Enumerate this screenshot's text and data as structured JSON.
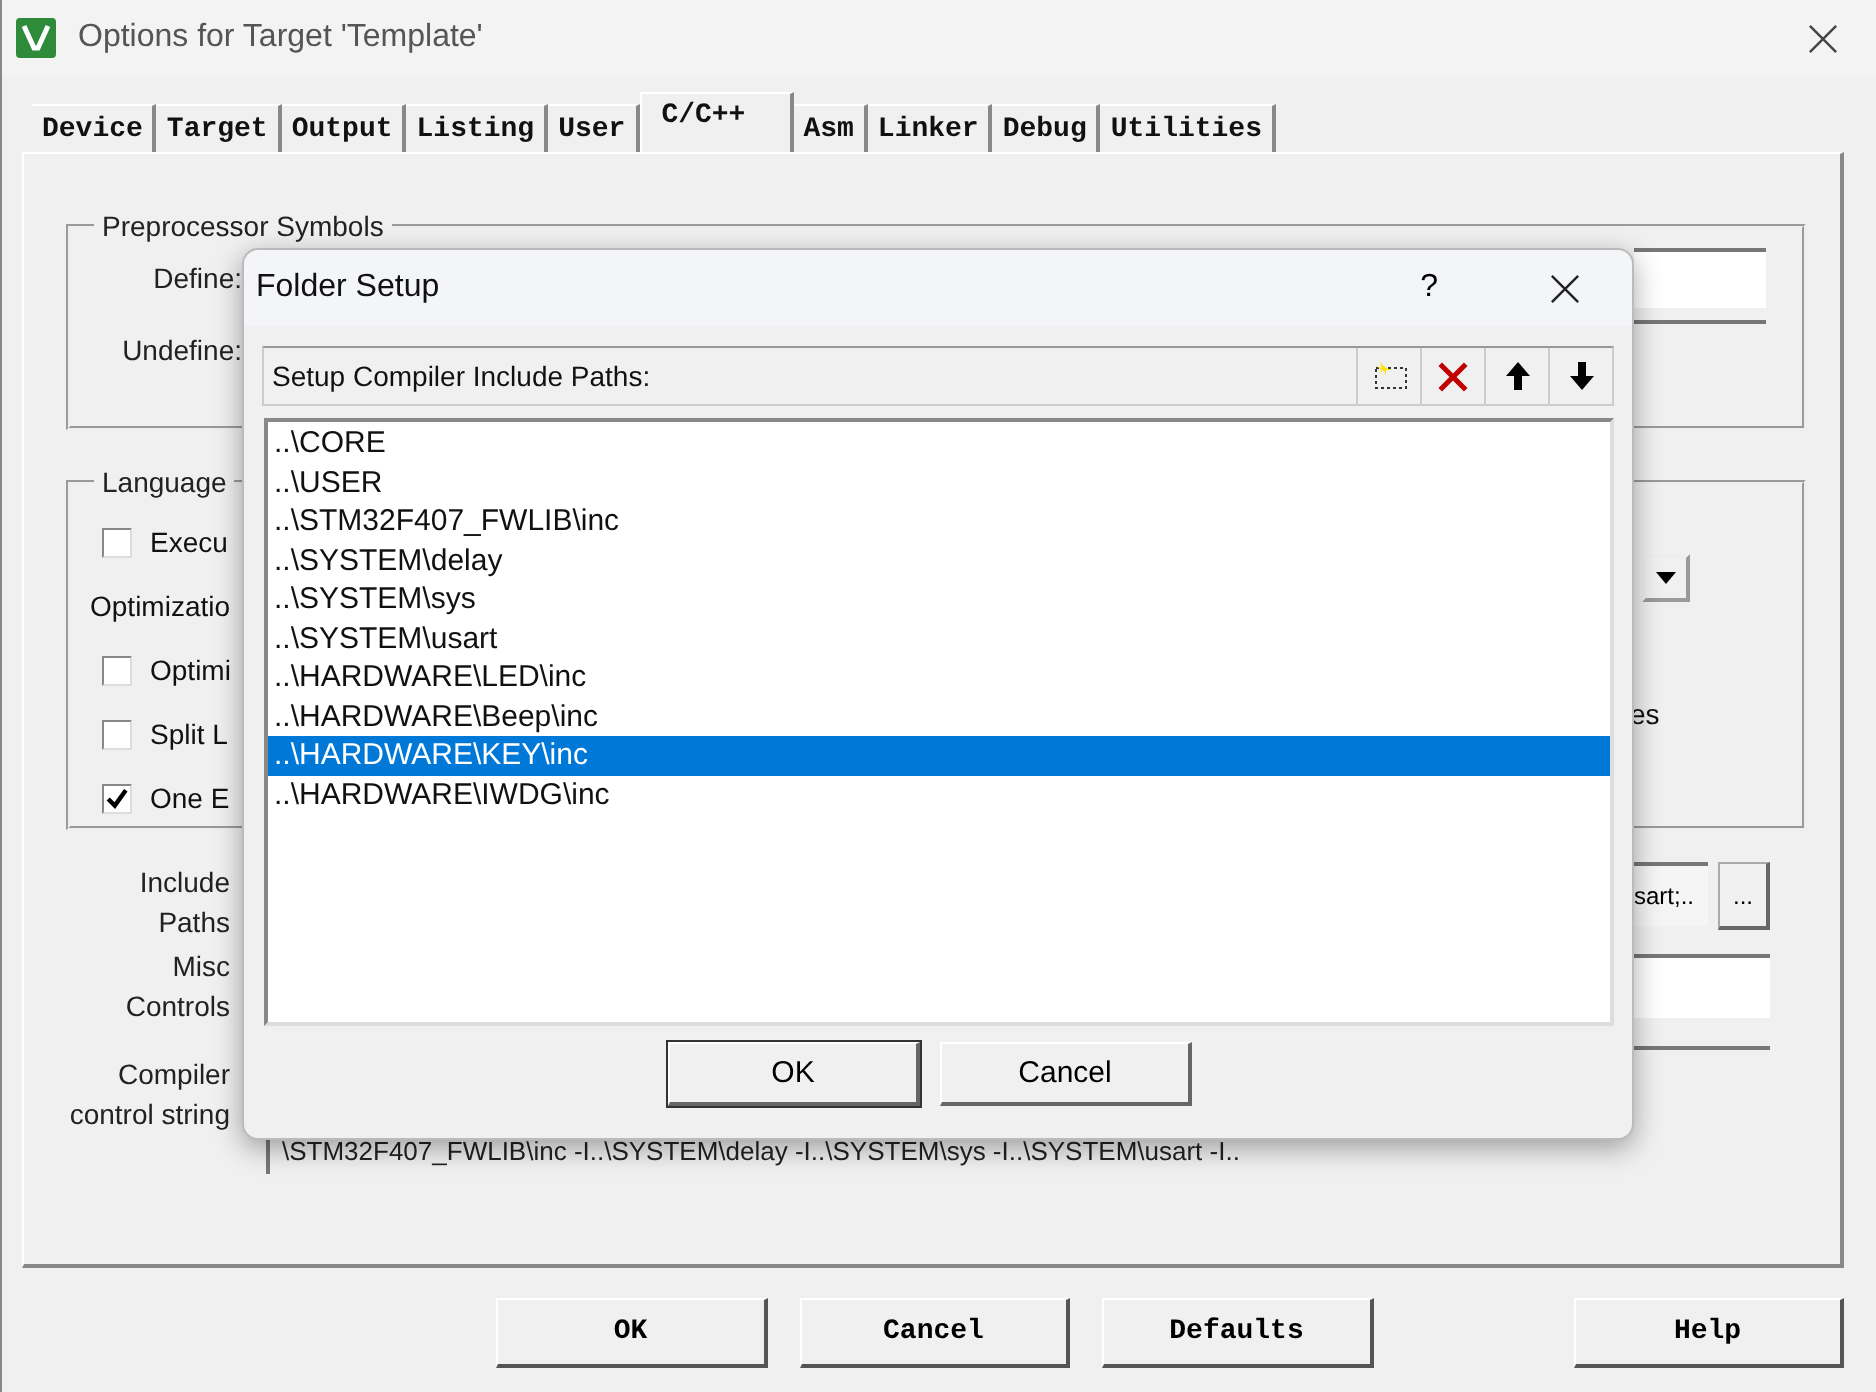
{
  "window": {
    "title": "Options for Target 'Template'"
  },
  "tabs": [
    {
      "label": "Device",
      "selected": false
    },
    {
      "label": "Target",
      "selected": false
    },
    {
      "label": "Output",
      "selected": false
    },
    {
      "label": "Listing",
      "selected": false
    },
    {
      "label": "User",
      "selected": false
    },
    {
      "label": "C/C++",
      "selected": true
    },
    {
      "label": "Asm",
      "selected": false
    },
    {
      "label": "Linker",
      "selected": false
    },
    {
      "label": "Debug",
      "selected": false
    },
    {
      "label": "Utilities",
      "selected": false
    }
  ],
  "preprocessor": {
    "title": "Preprocessor Symbols",
    "define_label": "Define:",
    "undefine_label": "Undefine:"
  },
  "language": {
    "title": "Language",
    "options": [
      {
        "kind": "checkbox",
        "label": "Execu",
        "checked": false
      },
      {
        "kind": "label",
        "label": "Optimizatio"
      },
      {
        "kind": "checkbox",
        "label": "Optimi",
        "checked": false
      },
      {
        "kind": "checkbox",
        "label": "Split L",
        "checked": false
      },
      {
        "kind": "checkbox",
        "label": "One E",
        "checked": true
      }
    ],
    "right_text": "es"
  },
  "include_paths": {
    "label": "Include Paths",
    "value": "sart;..",
    "browse": "..."
  },
  "misc_controls": {
    "label": "Misc Controls"
  },
  "compiler_string": {
    "label": "Compiler control string",
    "value": "\\STM32F407_FWLIB\\inc -I..\\SYSTEM\\delay -I..\\SYSTEM\\sys -I..\\SYSTEM\\usart -I.."
  },
  "buttons": [
    "OK",
    "Cancel",
    "Defaults",
    "Help"
  ],
  "dialog": {
    "title": "Folder Setup",
    "help": "?",
    "list_label": "Setup Compiler Include Paths:",
    "paths": [
      {
        "text": "..\\CORE",
        "selected": false
      },
      {
        "text": "..\\USER",
        "selected": false
      },
      {
        "text": "..\\STM32F407_FWLIB\\inc",
        "selected": false
      },
      {
        "text": "..\\SYSTEM\\delay",
        "selected": false
      },
      {
        "text": "..\\SYSTEM\\sys",
        "selected": false
      },
      {
        "text": "..\\SYSTEM\\usart",
        "selected": false
      },
      {
        "text": "..\\HARDWARE\\LED\\inc",
        "selected": false
      },
      {
        "text": "..\\HARDWARE\\Beep\\inc",
        "selected": false
      },
      {
        "text": "..\\HARDWARE\\KEY\\inc",
        "selected": true
      },
      {
        "text": "..\\HARDWARE\\IWDG\\inc",
        "selected": false
      }
    ],
    "buttons": [
      "OK",
      "Cancel"
    ]
  }
}
